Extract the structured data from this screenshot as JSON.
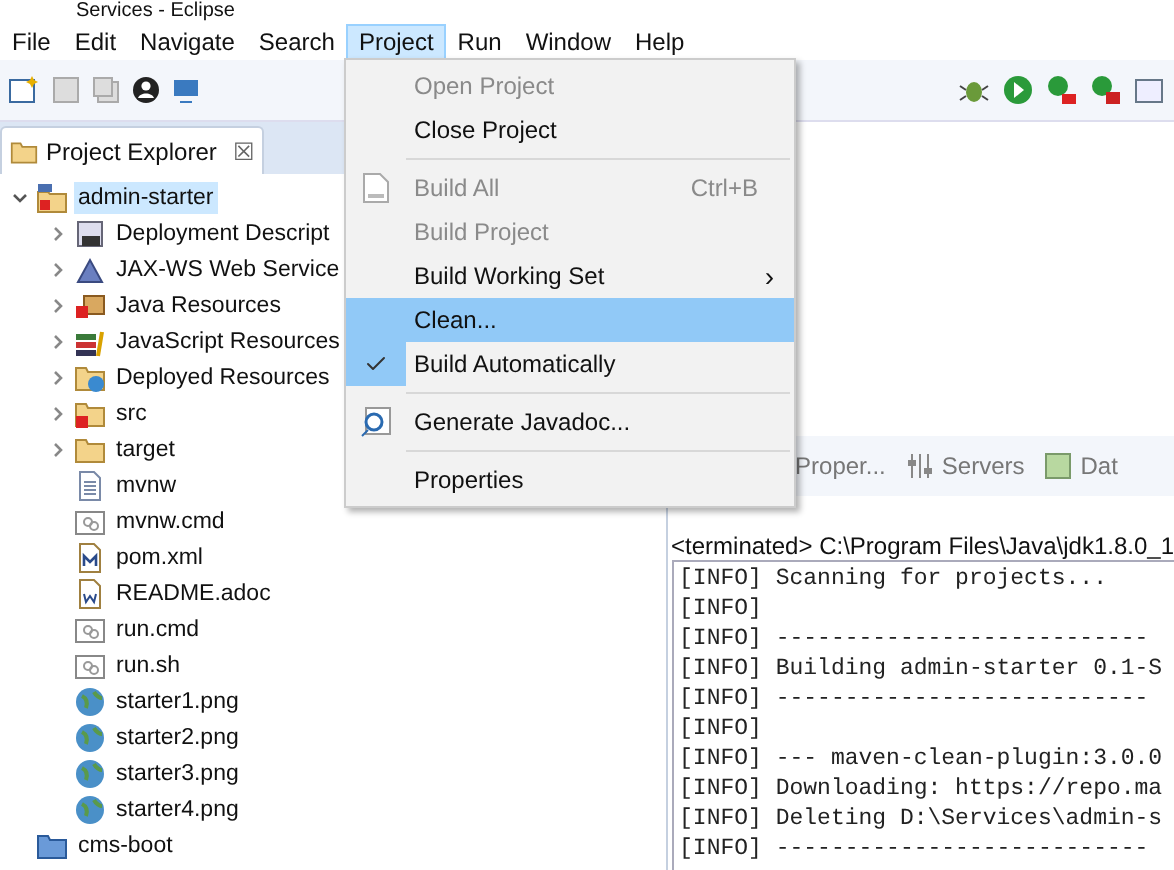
{
  "window": {
    "title": "Services - Eclipse"
  },
  "menubar": [
    {
      "label": "File",
      "selected": false
    },
    {
      "label": "Edit",
      "selected": false
    },
    {
      "label": "Navigate",
      "selected": false
    },
    {
      "label": "Search",
      "selected": false
    },
    {
      "label": "Project",
      "selected": true
    },
    {
      "label": "Run",
      "selected": false
    },
    {
      "label": "Window",
      "selected": false
    },
    {
      "label": "Help",
      "selected": false
    }
  ],
  "explorer": {
    "tab": {
      "label": "Project Explorer",
      "close": "☒"
    },
    "tree": [
      {
        "label": "admin-starter",
        "kind": "project",
        "expanded": true,
        "selected": true,
        "children": [
          {
            "label": "Deployment Descript",
            "kind": "descriptor",
            "expanded": false,
            "selected": false
          },
          {
            "label": "JAX-WS Web Service",
            "kind": "webservice",
            "expanded": false,
            "selected": false
          },
          {
            "label": "Java Resources",
            "kind": "javares",
            "expanded": false,
            "selected": false
          },
          {
            "label": "JavaScript Resources",
            "kind": "jsres",
            "expanded": false,
            "selected": false
          },
          {
            "label": "Deployed Resources",
            "kind": "deployed",
            "expanded": false,
            "selected": false
          },
          {
            "label": "src",
            "kind": "folder-error",
            "expanded": false,
            "selected": false
          },
          {
            "label": "target",
            "kind": "folder",
            "expanded": false,
            "selected": false
          },
          {
            "label": "mvnw",
            "kind": "text",
            "selected": false
          },
          {
            "label": "mvnw.cmd",
            "kind": "script",
            "selected": false
          },
          {
            "label": "pom.xml",
            "kind": "maven",
            "selected": false
          },
          {
            "label": "README.adoc",
            "kind": "doc",
            "selected": false
          },
          {
            "label": "run.cmd",
            "kind": "script",
            "selected": false
          },
          {
            "label": "run.sh",
            "kind": "script",
            "selected": false
          },
          {
            "label": "starter1.png",
            "kind": "image",
            "selected": false
          },
          {
            "label": "starter2.png",
            "kind": "image",
            "selected": false
          },
          {
            "label": "starter3.png",
            "kind": "image",
            "selected": false
          },
          {
            "label": "starter4.png",
            "kind": "image",
            "selected": false
          }
        ]
      },
      {
        "label": "cms-boot",
        "kind": "closed-project",
        "selected": false
      }
    ]
  },
  "project_menu": [
    {
      "kind": "item",
      "label": "Open Project",
      "disabled": true,
      "selected": false,
      "checked": false
    },
    {
      "kind": "item",
      "label": "Close Project",
      "disabled": false,
      "selected": false,
      "checked": false
    },
    {
      "kind": "separator"
    },
    {
      "kind": "binary-item",
      "label": "Build All",
      "shortcut": "Ctrl+B",
      "disabled": true,
      "selected": false,
      "checked": false
    },
    {
      "kind": "item",
      "label": "Build Project",
      "disabled": true,
      "selected": false,
      "checked": false
    },
    {
      "kind": "item",
      "label": "Build Working Set",
      "submenu": "›",
      "disabled": false,
      "selected": false,
      "checked": false
    },
    {
      "kind": "item",
      "label": "Clean...",
      "disabled": false,
      "selected": true,
      "checked": false
    },
    {
      "kind": "item",
      "label": "Build Automatically",
      "disabled": false,
      "selected": false,
      "checked": true
    },
    {
      "kind": "separator"
    },
    {
      "kind": "javadoc-item",
      "label": "Generate Javadoc...",
      "disabled": false,
      "selected": false,
      "checked": false
    },
    {
      "kind": "separator"
    },
    {
      "kind": "item",
      "label": "Properties",
      "disabled": false,
      "selected": false,
      "checked": false
    }
  ],
  "bottom_tabs": [
    {
      "label": "Proper...",
      "kind": "properties"
    },
    {
      "label": "Servers",
      "kind": "servers"
    },
    {
      "label": "Dat",
      "kind": "data"
    }
  ],
  "console": {
    "header": "<terminated> C:\\Program Files\\Java\\jdk1.8.0_1",
    "lines": [
      "[INFO] Scanning for projects...",
      "[INFO]",
      "[INFO] ---------------------------",
      "[INFO] Building admin-starter 0.1-S",
      "[INFO] ---------------------------",
      "[INFO]",
      "[INFO] --- maven-clean-plugin:3.0.0",
      "[INFO] Downloading: https://repo.ma",
      "[INFO] Deleting D:\\Services\\admin-s",
      "[INFO] ---------------------------"
    ]
  }
}
